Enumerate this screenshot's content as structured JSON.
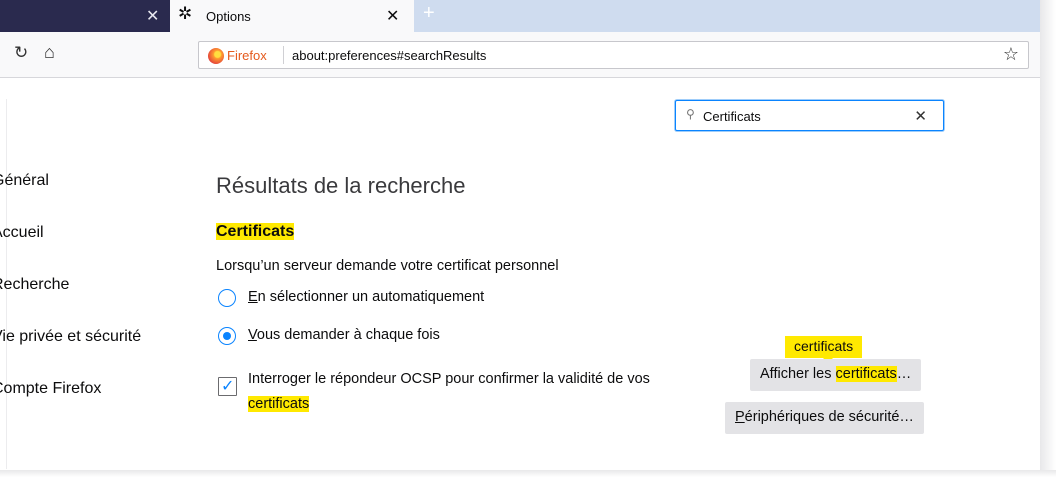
{
  "tabs": {
    "background_tab_close": "✕",
    "active_tab_title": "Options",
    "active_tab_close": "✕",
    "new_tab": "+"
  },
  "navbar": {
    "identity_label": "Firefox",
    "url": "about:preferences#searchResults"
  },
  "search": {
    "query": "Certificats",
    "clear": "✕"
  },
  "sidebar": {
    "items": [
      {
        "label": "Général"
      },
      {
        "label": "Accueil"
      },
      {
        "label": "Recherche"
      },
      {
        "label": "Vie privée et sécurité"
      },
      {
        "label": "Compte Firefox"
      }
    ]
  },
  "main": {
    "heading": "Résultats de la recherche",
    "section_title": "Certificats",
    "description": "Lorsqu’un serveur demande votre certificat personnel",
    "radio_auto": {
      "label_first": "E",
      "label_rest": "n sélectionner un automatiquement",
      "selected": false
    },
    "radio_ask": {
      "label_first": "V",
      "label_rest": "ous demander à chaque fois",
      "selected": true
    },
    "ocsp": {
      "text": "Interroger le répondeur OCSP pour confirmer la validité de vos",
      "highlight": "certificats",
      "checked": true
    },
    "tooltip": "certificats",
    "view_certs_button": {
      "prefix": "Afficher les ",
      "highlight": "certificats",
      "suffix": "…"
    },
    "devices_button": {
      "first": "P",
      "rest": "ériphériques de sécurité…"
    }
  },
  "colors": {
    "accent": "#0a84ff",
    "highlight": "#ffe900",
    "dark_tab": "#2a2a4e",
    "tabstrip": "#cfdcef"
  }
}
